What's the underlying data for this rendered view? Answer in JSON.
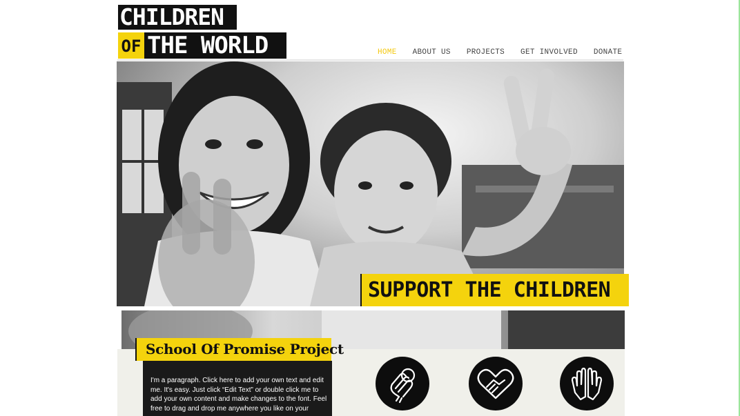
{
  "logo": {
    "line1": "CHILDREN",
    "of": "OF",
    "line2": "THE WORLD"
  },
  "nav": {
    "items": [
      {
        "label": "HOME",
        "active": true
      },
      {
        "label": "ABOUT US",
        "active": false
      },
      {
        "label": "PROJECTS",
        "active": false
      },
      {
        "label": "GET INVOLVED",
        "active": false
      },
      {
        "label": "DONATE",
        "active": false
      }
    ]
  },
  "hero": {
    "banner": "SUPPORT THE CHILDREN"
  },
  "project": {
    "title": "School Of Promise Project",
    "text": "I'm a paragraph. Click here to add your own text and edit me. It's easy. Just click “Edit Text” or double click me to add your own content and make changes to the font. Feel free to drag and drop me anywhere you like on your"
  },
  "icons": [
    "raised-hand-icon",
    "handshake-heart-icon",
    "open-hands-icon"
  ],
  "colors": {
    "accent": "#f4d30d",
    "nav_active": "#f4c80d",
    "dark": "#111111",
    "lower_bg": "#f0f0ea"
  }
}
